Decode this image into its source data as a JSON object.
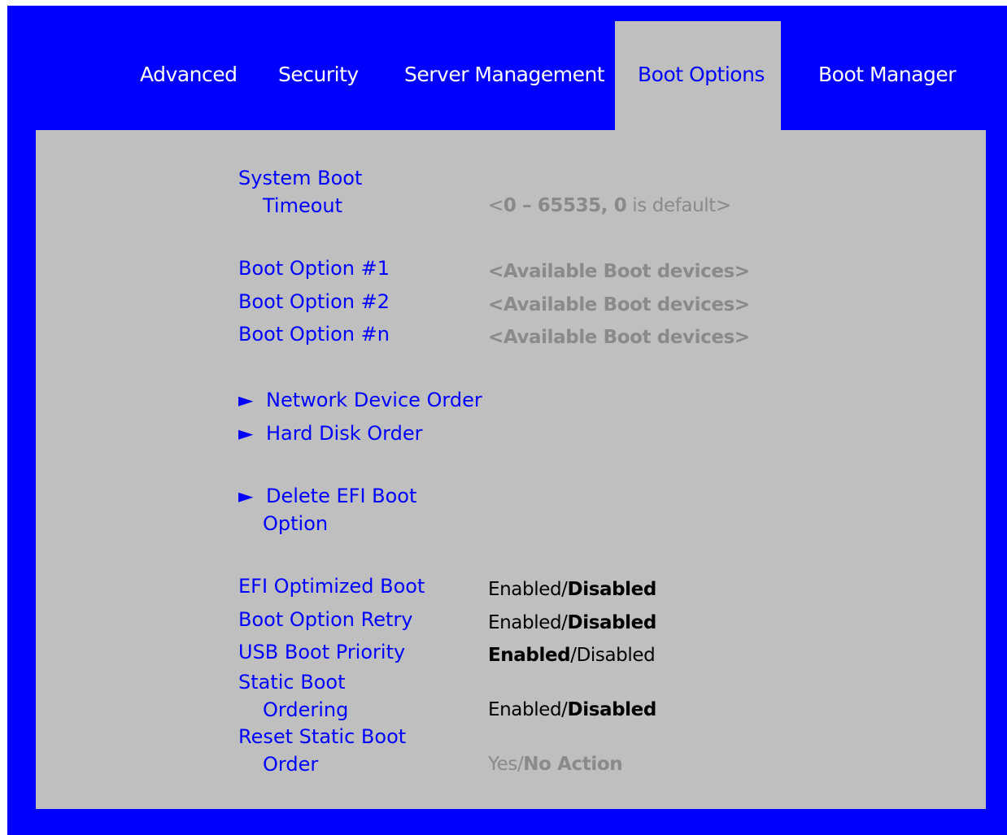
{
  "tabs": [
    {
      "label": "Advanced",
      "active": false
    },
    {
      "label": "Security",
      "active": false
    },
    {
      "label": "Server Management",
      "active": false
    },
    {
      "label": "Boot Options",
      "active": true
    },
    {
      "label": "Boot Manager",
      "active": false
    }
  ],
  "settings": {
    "system_boot_timeout": {
      "label_line1": "System Boot",
      "label_line2": "Timeout",
      "value_open": "<",
      "value_bold": "0 – 65535, 0",
      "value_rest": " is default",
      "value_close": ">"
    },
    "boot_option_1": {
      "label": "Boot Option #1",
      "value": "<Available Boot devices>"
    },
    "boot_option_2": {
      "label": "Boot Option #2",
      "value": "<Available Boot devices>"
    },
    "boot_option_n": {
      "label": "Boot Option #n",
      "value": "<Available Boot devices>"
    },
    "network_device_order": {
      "arrow": "►",
      "label": "Network Device Order"
    },
    "hard_disk_order": {
      "arrow": "►",
      "label": "Hard Disk Order"
    },
    "delete_efi_boot_option": {
      "arrow": "►",
      "label_line1": "Delete EFI Boot",
      "label_line2": "Option"
    },
    "efi_optimized_boot": {
      "label": "EFI Optimized Boot",
      "value_a": "Enabled",
      "sep": "/",
      "value_b": "Disabled",
      "selected": "Disabled"
    },
    "boot_option_retry": {
      "label": "Boot Option Retry",
      "value_a": "Enabled",
      "sep": "/",
      "value_b": "Disabled",
      "selected": "Disabled"
    },
    "usb_boot_priority": {
      "label": "USB Boot Priority",
      "value_a": "Enabled",
      "sep": "/",
      "value_b": "Disabled",
      "selected": "Enabled"
    },
    "static_boot_ordering": {
      "label_line1": "Static Boot",
      "label_line2": "Ordering",
      "value_a": "Enabled",
      "sep": "/",
      "value_b": "Disabled",
      "selected": "Disabled"
    },
    "reset_static_boot_order": {
      "label_line1": "Reset Static Boot",
      "label_line2": "Order",
      "value_a": "Yes",
      "sep": "/",
      "value_b": "No Action",
      "selected": "No Action"
    }
  },
  "colors": {
    "frame": "#0000ff",
    "panel": "#bfbfbf",
    "label": "#0000ff",
    "value_readonly": "#8a8a8a",
    "value_editable": "#000000",
    "tab_inactive_text": "#ffffff"
  }
}
